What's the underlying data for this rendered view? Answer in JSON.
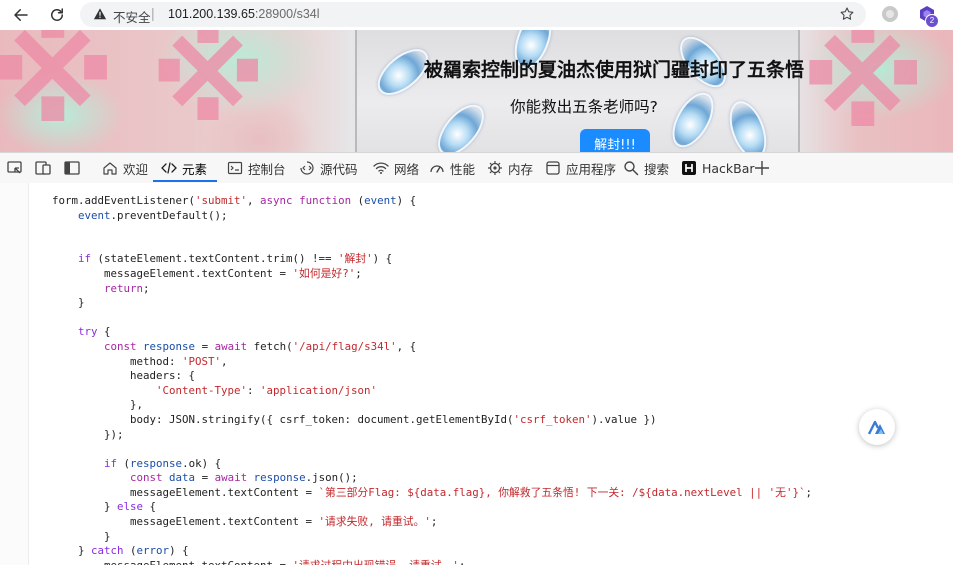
{
  "browser": {
    "insecure_label": "不安全",
    "separator": "|",
    "url_host": "101.200.139.65",
    "url_rest": ":28900/s34l",
    "ext_badge": "2"
  },
  "page": {
    "top_text": "",
    "title": "被羂索控制的夏油杰使用狱门疆封印了五条悟",
    "subtitle": "你能救出五条老师吗?",
    "button_label": "解封!!!"
  },
  "devtools": {
    "tabs": [
      {
        "label": "欢迎",
        "icon": "home-icon"
      },
      {
        "label": "元素",
        "icon": "code-icon"
      },
      {
        "label": "控制台",
        "icon": "console-icon"
      },
      {
        "label": "源代码",
        "icon": "sources-icon"
      },
      {
        "label": "网络",
        "icon": "wifi-icon"
      },
      {
        "label": "性能",
        "icon": "performance-icon"
      },
      {
        "label": "内存",
        "icon": "memory-icon"
      },
      {
        "label": "应用程序",
        "icon": "application-icon"
      },
      {
        "label": "搜索",
        "icon": "search-icon"
      },
      {
        "label": "HackBar",
        "icon": "hackbar-icon"
      }
    ],
    "active_tab": "元素"
  },
  "code": {
    "lines": [
      "        form.addEventListener('submit', async function (event) {",
      "            event.preventDefault();",
      "",
      "",
      "            if (stateElement.textContent.trim() !== '解封') {",
      "                messageElement.textContent = '如何是好?';",
      "                return;",
      "            }",
      "",
      "            try {",
      "                const response = await fetch('/api/flag/s34l', {",
      "                    method: 'POST',",
      "                    headers: {",
      "                        'Content-Type': 'application/json'",
      "                    },",
      "                    body: JSON.stringify({ csrf_token: document.getElementById('csrf_token').value })",
      "                });",
      "",
      "                if (response.ok) {",
      "                    const data = await response.json();",
      "                    messageElement.textContent = `第三部分Flag: ${data.flag}, 你解救了五条悟! 下一关: /${data.nextLevel || '无'}`;",
      "                } else {",
      "                    messageElement.textContent = '请求失败, 请重试。';",
      "                }",
      "            } catch (error) {",
      "                messageElement.textContent = '请求过程中出现错误, 请重试。';"
    ]
  }
}
